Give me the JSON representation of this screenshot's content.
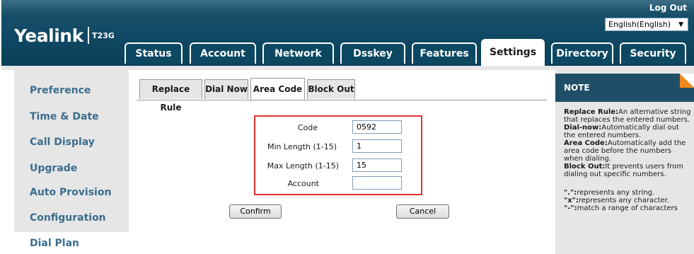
{
  "header": {
    "logo": "Yealink",
    "model": "T23G",
    "logout": "Log Out",
    "language": "English(English)"
  },
  "nav": {
    "tabs": [
      {
        "label": "Status"
      },
      {
        "label": "Account"
      },
      {
        "label": "Network"
      },
      {
        "label": "Dsskey"
      },
      {
        "label": "Features"
      },
      {
        "label": "Settings",
        "active": true
      },
      {
        "label": "Directory"
      },
      {
        "label": "Security"
      }
    ]
  },
  "sidebar": {
    "items": [
      {
        "label": "Preference"
      },
      {
        "label": "Time & Date"
      },
      {
        "label": "Call Display"
      },
      {
        "label": "Upgrade"
      },
      {
        "label": "Auto Provision"
      },
      {
        "label": "Configuration"
      },
      {
        "label": "Dial Plan",
        "active": true
      }
    ]
  },
  "subtabs": [
    {
      "label": "Replace Rule"
    },
    {
      "label": "Dial Now"
    },
    {
      "label": "Area Code",
      "active": true
    },
    {
      "label": "Block Out"
    }
  ],
  "form": {
    "code": {
      "label": "Code",
      "value": "0592"
    },
    "min_length": {
      "label": "Min Length (1-15)",
      "value": "1"
    },
    "max_length": {
      "label": "Max Length (1-15)",
      "value": "15"
    },
    "account": {
      "label": "Account",
      "value": ""
    }
  },
  "buttons": {
    "confirm": "Confirm",
    "cancel": "Cancel"
  },
  "note": {
    "title": "NOTE",
    "replace_rule_key": "Replace Rule:",
    "replace_rule_text": "An alternative string that replaces the entered numbers.",
    "dial_now_key": "Dial-now:",
    "dial_now_text": "Automatically dial out the entered numbers.",
    "area_code_key": "Area Code:",
    "area_code_text": "Automatically add the area code before the numbers when dialing.",
    "block_out_key": "Block Out:",
    "block_out_text": "It prevents users from dialing out specific numbers.",
    "dot_key": "\".\":",
    "dot_text": "represents any string.",
    "x_key": "\"x\":",
    "x_text": "represents any character.",
    "dash_key": "\"-\":",
    "dash_text": "match a range of characters"
  },
  "colors": {
    "header_bg": "#0e4761",
    "sidebar_text": "#3b6d8d",
    "form_border": "#e03030",
    "note_head": "#1f4f67",
    "note_accent": "#ef8a1a"
  }
}
